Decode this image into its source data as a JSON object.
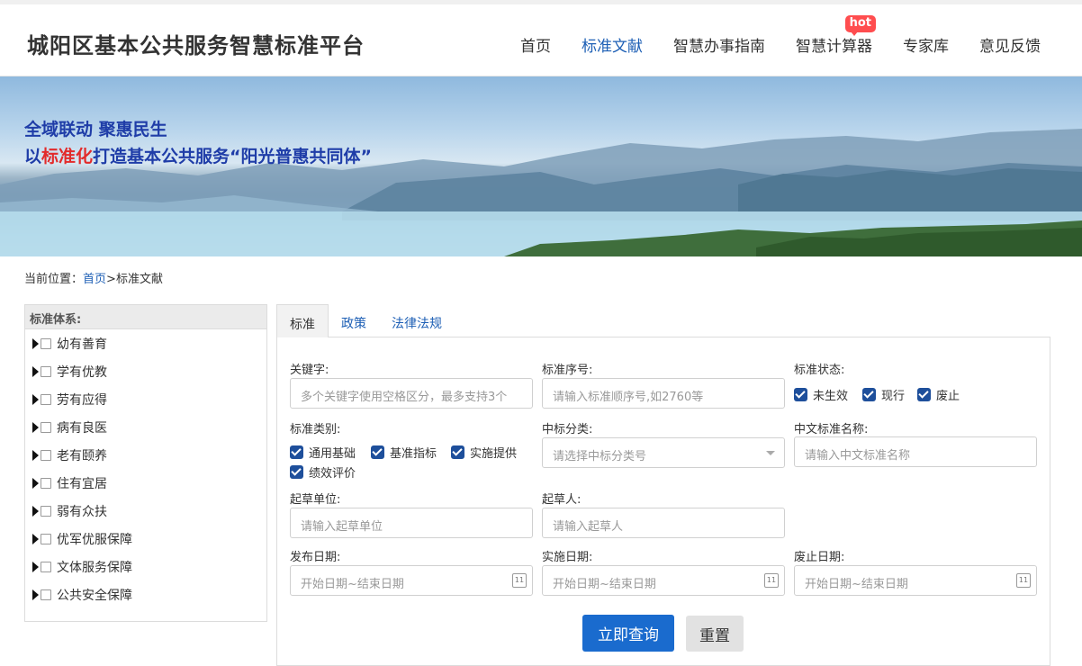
{
  "site": {
    "title": "城阳区基本公共服务智慧标准平台"
  },
  "nav": {
    "items": [
      {
        "label": "首页"
      },
      {
        "label": "标准文献"
      },
      {
        "label": "智慧办事指南"
      },
      {
        "label": "智慧计算器",
        "badge": "hot"
      },
      {
        "label": "专家库"
      },
      {
        "label": "意见反馈"
      }
    ],
    "active": "标准文献",
    "active_color": "#1d5fb5"
  },
  "banner": {
    "line1": "全域联动 聚惠民生",
    "line2_prefix": "以",
    "line2_highlight": "标准化",
    "line2_suffix": "打造基本公共服务“阳光普惠共同体”"
  },
  "breadcrumb": {
    "prefix": "当前位置：",
    "home": "首页",
    "sep": ">",
    "current": "标准文献"
  },
  "sidebar": {
    "title": "标准体系:",
    "items": [
      {
        "label": "幼有善育"
      },
      {
        "label": "学有优教"
      },
      {
        "label": "劳有应得"
      },
      {
        "label": "病有良医"
      },
      {
        "label": "老有颐养"
      },
      {
        "label": "住有宜居"
      },
      {
        "label": "弱有众扶"
      },
      {
        "label": "优军优服保障"
      },
      {
        "label": "文体服务保障"
      },
      {
        "label": "公共安全保障"
      }
    ]
  },
  "tabs": [
    {
      "label": "标准"
    },
    {
      "label": "政策"
    },
    {
      "label": "法律法规"
    }
  ],
  "form": {
    "keyword": {
      "label": "关键字:",
      "placeholder": "多个关键字使用空格区分，最多支持3个"
    },
    "serial": {
      "label": "标准序号:",
      "placeholder": "请输入标准顺序号,如2760等"
    },
    "status": {
      "label": "标准状态:",
      "options": [
        "未生效",
        "现行",
        "废止"
      ]
    },
    "category": {
      "label": "标准类别:",
      "options": [
        "通用基础",
        "基准指标",
        "实施提供",
        "绩效评价"
      ]
    },
    "ccs": {
      "label": "中标分类:",
      "placeholder": "请选择中标分类号"
    },
    "cn_name": {
      "label": "中文标准名称:",
      "placeholder": "请输入中文标准名称"
    },
    "drafting_unit": {
      "label": "起草单位:",
      "placeholder": "请输入起草单位"
    },
    "drafter": {
      "label": "起草人:",
      "placeholder": "请输入起草人"
    },
    "publish_date": {
      "label": "发布日期:",
      "placeholder": "开始日期~结束日期"
    },
    "implement_date": {
      "label": "实施日期:",
      "placeholder": "开始日期~结束日期"
    },
    "abolish_date": {
      "label": "废止日期:",
      "placeholder": "开始日期~结束日期"
    },
    "calendar_day": "11",
    "search_button": "立即查询",
    "reset_button": "重置"
  }
}
